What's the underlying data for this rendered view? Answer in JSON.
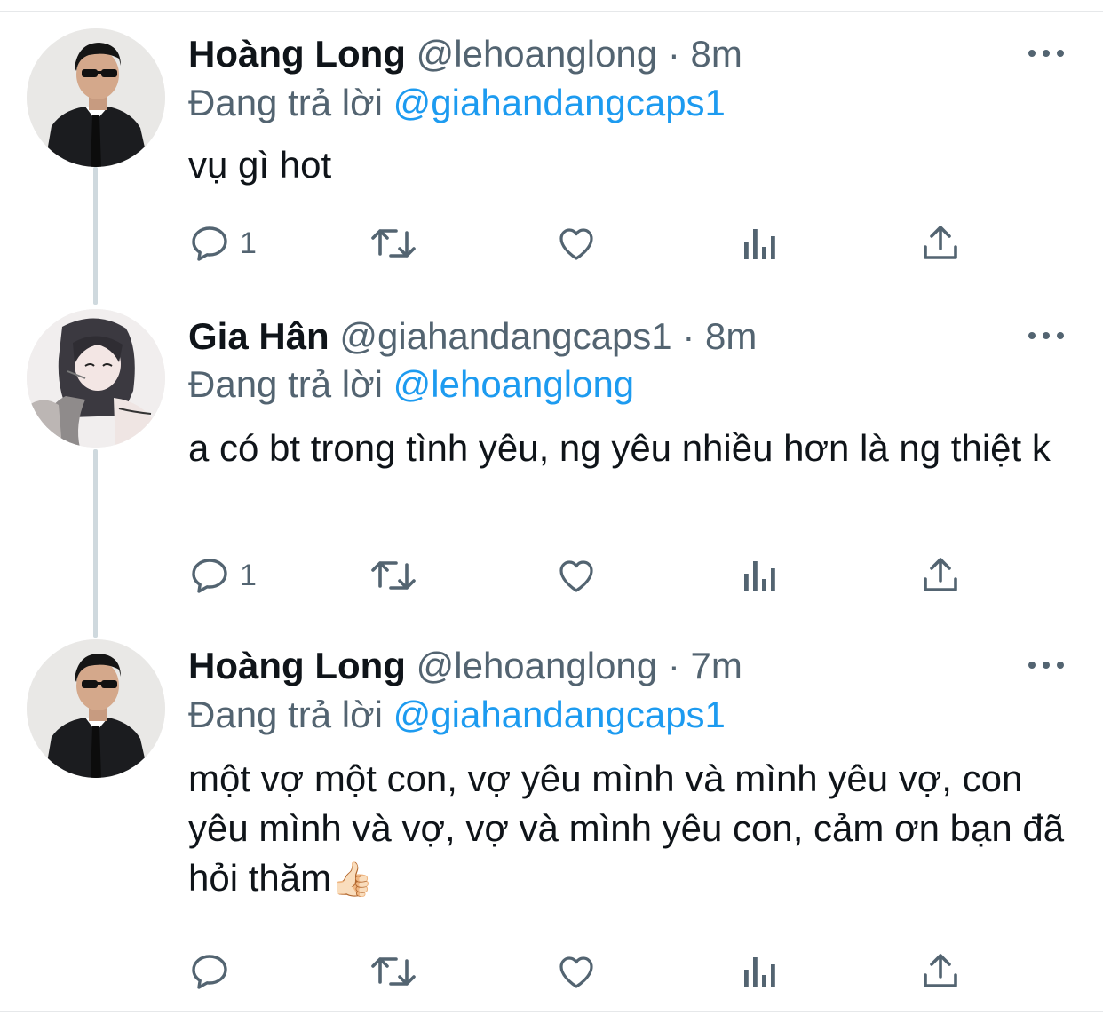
{
  "thread": [
    {
      "name": "Hoàng Long",
      "handle": "@lehoanglong",
      "time": "8m",
      "reply_prefix": "Đang trả lời",
      "reply_to": "@giahandangcaps1",
      "text": "vụ gì hot",
      "reply_count": "1",
      "avatar": "man-in-sunglasses-avatar"
    },
    {
      "name": "Gia Hân",
      "handle": "@giahandangcaps1",
      "time": "8m",
      "reply_prefix": "Đang trả lời",
      "reply_to": "@lehoanglong",
      "text": "a có bt trong tình yêu, ng yêu nhiều hơn là ng thiệt k",
      "reply_count": "1",
      "avatar": "anime-girl-sketch-avatar"
    },
    {
      "name": "Hoàng Long",
      "handle": "@lehoanglong",
      "time": "7m",
      "reply_prefix": "Đang trả lời",
      "reply_to": "@giahandangcaps1",
      "text": "một vợ một con, vợ yêu mình và mình yêu vợ, con yêu mình và vợ, vợ và mình yêu con, cảm ơn bạn đã hỏi thăm",
      "emoji": "👍🏻",
      "reply_count": "",
      "avatar": "man-in-sunglasses-avatar"
    }
  ],
  "separator": "·",
  "icons": {
    "reply": "reply-bubble-icon",
    "retweet": "retweet-icon",
    "like": "heart-icon",
    "analytics": "analytics-bars-icon",
    "share": "share-upload-icon",
    "more": "more-dots-icon"
  },
  "colors": {
    "accent": "#1d9bf0",
    "secondary_text": "#536471",
    "primary_text": "#0f1419",
    "thread_line": "#cfd9de"
  }
}
